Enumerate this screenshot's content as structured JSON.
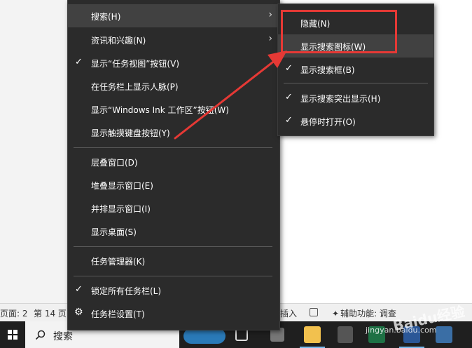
{
  "statusbar": {
    "page": "页面: 2",
    "pages": "第 14 页",
    "insert": "插入",
    "accessibility": "辅助功能: 调查"
  },
  "taskbar": {
    "search_placeholder": "搜索"
  },
  "context_menu": {
    "items": [
      {
        "label": "搜索(H)",
        "checked": false,
        "submenu": true
      },
      {
        "label": "资讯和兴趣(N)",
        "checked": false,
        "submenu": true
      },
      {
        "label": "显示“任务视图”按钮(V)",
        "checked": true
      },
      {
        "label": "在任务栏上显示人脉(P)",
        "checked": false
      },
      {
        "label": "显示“Windows Ink 工作区”按钮(W)",
        "checked": false
      },
      {
        "label": "显示触摸键盘按钮(Y)",
        "checked": false
      },
      {
        "label": "层叠窗口(D)",
        "checked": false
      },
      {
        "label": "堆叠显示窗口(E)",
        "checked": false
      },
      {
        "label": "并排显示窗口(I)",
        "checked": false
      },
      {
        "label": "显示桌面(S)",
        "checked": false
      },
      {
        "label": "任务管理器(K)",
        "checked": false
      },
      {
        "label": "锁定所有任务栏(L)",
        "checked": true
      },
      {
        "label": "任务栏设置(T)",
        "checked": false
      }
    ]
  },
  "search_submenu": {
    "items": [
      {
        "label": "隐藏(N)",
        "checked": false
      },
      {
        "label": "显示搜索图标(W)",
        "checked": false
      },
      {
        "label": "显示搜索框(B)",
        "checked": true
      },
      {
        "label": "显示搜索突出显示(H)",
        "checked": true
      },
      {
        "label": "悬停时打开(O)",
        "checked": true
      }
    ]
  },
  "icons": {
    "check": "✓",
    "chevron": "›",
    "gear": "⚙"
  },
  "annotation": {
    "color": "#e53935"
  },
  "watermark": {
    "main": "Baidu经验",
    "sub": "jingyan.baidu.com"
  }
}
